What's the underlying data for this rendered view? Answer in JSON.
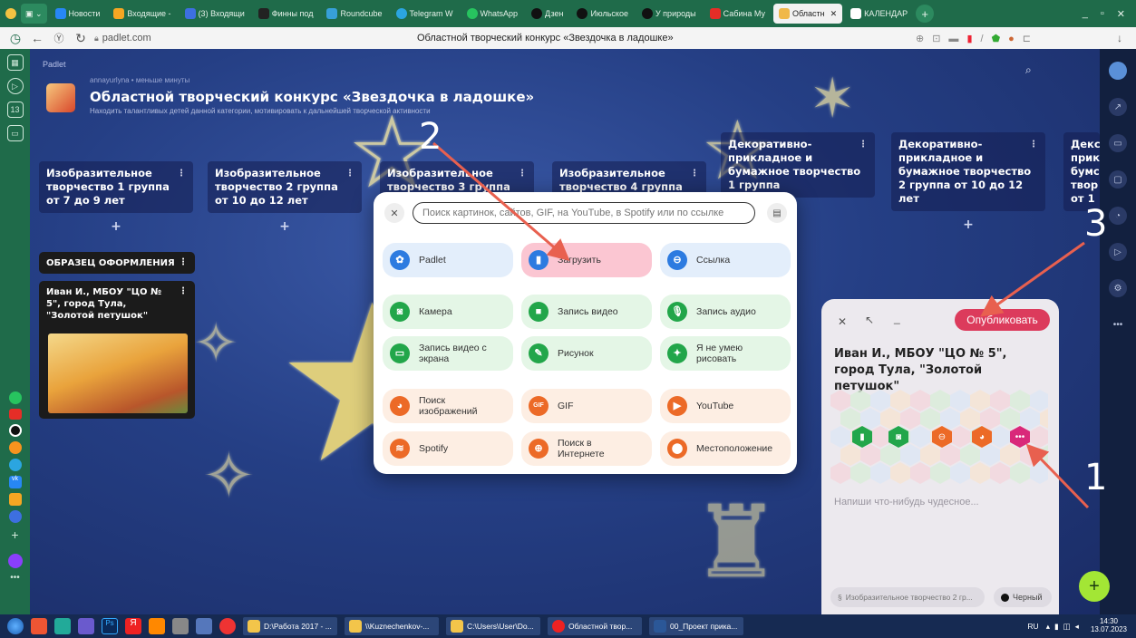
{
  "browser": {
    "tabs": [
      "Новости",
      "Входящие -",
      "(3) Входящи",
      "Финны под",
      "Roundcube",
      "Telegram W",
      "WhatsApp",
      "Дзен",
      "Июльское",
      "У природы",
      "Сабина Му",
      "Областн",
      "КАЛЕНДАР"
    ],
    "active_tab": 11,
    "url": "padlet.com",
    "page_title": "Областной творческий конкурс «Звездочка в ладошке»"
  },
  "board": {
    "brand": "Padlet",
    "author": "annayurlyna • меньше минуты",
    "title": "Областной творческий конкурс «Звездочка в ладошке»",
    "subtitle": "Находить талантливых детей данной категории, мотивировать к дальнейшей творческой активности",
    "columns": [
      {
        "title": "Изобразительное творчество 1 группа от 7 до 9 лет"
      },
      {
        "title": "Изобразительное творчество 2 группа от 10 до 12 лет"
      },
      {
        "title": "Изобразительное творчество 3 группа"
      },
      {
        "title": "Изобразительное творчество 4 группа"
      },
      {
        "title": "Декоративно-прикладное и бумажное творчество 1 группа"
      },
      {
        "title": "Декоративно-прикладное и бумажное творчество 2 группа от 10 до 12 лет"
      },
      {
        "title": "Декс прик бумс твор от 1"
      }
    ],
    "add_symbol": "+",
    "sample_section": "ОБРАЗЕЦ ОФОРМЛЕНИЯ",
    "sample_card_title": "Иван И., МБОУ \"ЦО № 5\", город Тула, \"Золотой петушок\""
  },
  "popup": {
    "search_placeholder": "Поиск картинок, сайтов, GIF, на YouTube, в Spotify или по ссылке",
    "options": [
      {
        "label": "Padlet",
        "icon": "padlet-icon",
        "color": "blue"
      },
      {
        "label": "Загрузить",
        "icon": "upload-icon",
        "color": "pink"
      },
      {
        "label": "Ссылка",
        "icon": "link-icon",
        "color": "blue"
      },
      {
        "label": "Камера",
        "icon": "camera-icon",
        "color": "green"
      },
      {
        "label": "Запись видео",
        "icon": "video-icon",
        "color": "green"
      },
      {
        "label": "Запись аудио",
        "icon": "mic-icon",
        "color": "green"
      },
      {
        "label": "Запись видео с экрана",
        "icon": "screen-record-icon",
        "color": "green"
      },
      {
        "label": "Рисунок",
        "icon": "draw-icon",
        "color": "green"
      },
      {
        "label": "Я не умею рисовать",
        "icon": "sparkle-icon",
        "color": "green"
      },
      {
        "label": "Поиск изображений",
        "icon": "image-search-icon",
        "color": "orange"
      },
      {
        "label": "GIF",
        "icon": "gif-icon",
        "color": "orange"
      },
      {
        "label": "YouTube",
        "icon": "youtube-icon",
        "color": "orange"
      },
      {
        "label": "Spotify",
        "icon": "spotify-icon",
        "color": "orange"
      },
      {
        "label": "Поиск в Интернете",
        "icon": "web-search-icon",
        "color": "orange"
      },
      {
        "label": "Местоположение",
        "icon": "location-icon",
        "color": "orange"
      }
    ]
  },
  "editor": {
    "publish": "Опубликовать",
    "post_title": "Иван И., МБОУ \"ЦО № 5\", город Тула, \"Золотой петушок\"",
    "body_placeholder": "Напиши что-нибудь чудесное...",
    "section": "Изобразительное творчество 2 гр...",
    "color": "Черный"
  },
  "annotations": [
    "1",
    "2",
    "3"
  ],
  "taskbar": {
    "windows": [
      "D:\\Работа 2017 - ...",
      "\\\\Kuznechenkov-...",
      "C:\\Users\\User\\Do...",
      "Областной твор...",
      "00_Проект прика..."
    ],
    "lang": "RU",
    "time": "14:30",
    "date": "13.07.2023"
  }
}
